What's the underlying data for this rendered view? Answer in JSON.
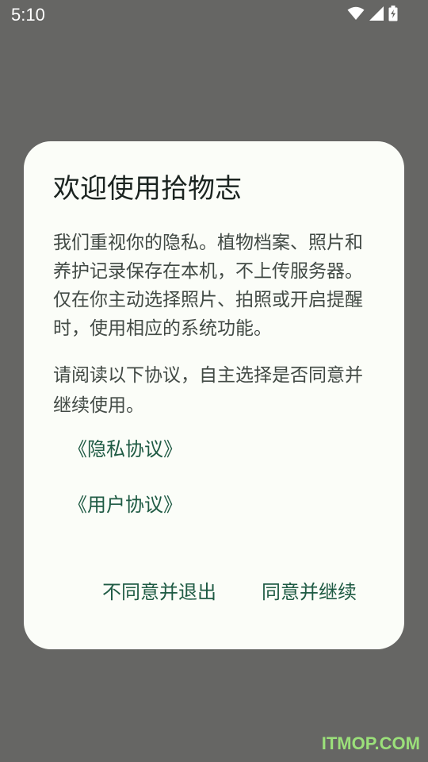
{
  "status_bar": {
    "time": "5:10",
    "icons": [
      "wifi-icon",
      "cellular-signal-icon",
      "battery-charging-icon"
    ]
  },
  "dialog": {
    "title": "欢迎使用拾物志",
    "body": "我们重视你的隐私。植物档案、照片和养护记录保存在本机，不上传服务器。仅在你主动选择照片、拍照或开启提醒时，使用相应的系统功能。",
    "hint": "请阅读以下协议，自主选择是否同意并继续使用。",
    "links": {
      "privacy": "《隐私协议》",
      "user": "《用户协议》"
    },
    "buttons": {
      "decline": "不同意并退出",
      "accept": "同意并继续"
    }
  },
  "watermark": "ITMOP.COM",
  "colors": {
    "scrim": "#666664",
    "dialog_bg": "#fbfdf8",
    "accent": "#1e5a43",
    "title": "#1b2420",
    "body_text": "#424a45"
  }
}
